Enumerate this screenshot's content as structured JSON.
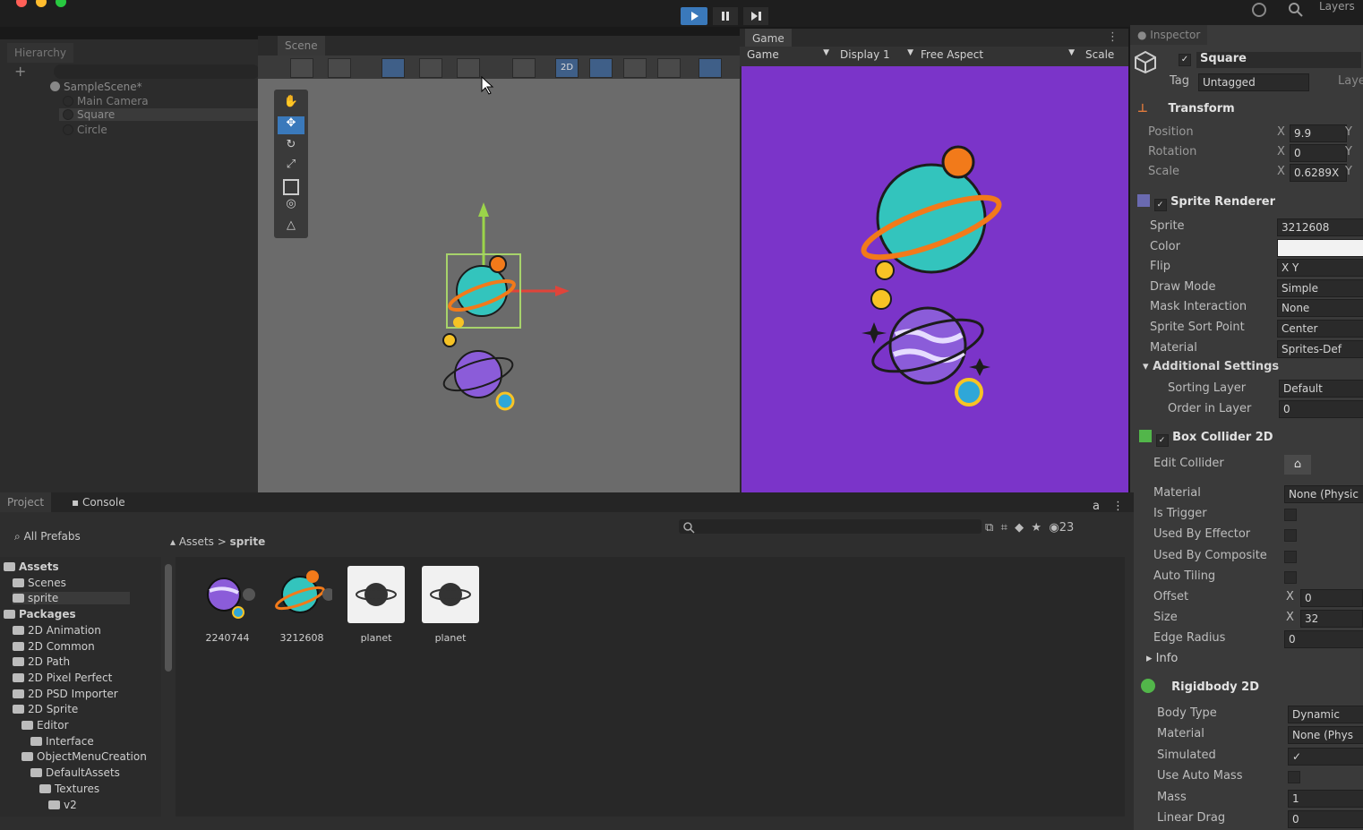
{
  "colors": {
    "accent": "#3a79bb",
    "game_bg": "#7b34c9",
    "planet_teal": "#33c4bd",
    "planet_purple": "#8b5cd9",
    "orange": "#f27a1a"
  },
  "toolbar": {
    "play_icon": "play-icon",
    "pause_icon": "pause-icon",
    "step_icon": "step-icon",
    "layers_label": "Layers"
  },
  "hierarchy": {
    "tab_label": "Hierarchy",
    "scene": "SampleScene*",
    "items": [
      "Main Camera",
      "Square",
      "Circle"
    ]
  },
  "scene": {
    "tab_label": "Scene",
    "mode_2d": "2D"
  },
  "game": {
    "tab_label": "Game",
    "view_select": "Game",
    "display": "Display 1",
    "aspect": "Free Aspect",
    "scale_label": "Scale"
  },
  "inspector": {
    "tab_label": "Inspector",
    "object_name": "Square",
    "tag_label": "Tag",
    "tag_value": "Untagged",
    "layer_label": "Layer",
    "transform": {
      "title": "Transform",
      "rows": [
        {
          "label": "Position",
          "axis": "X",
          "value": "9.9",
          "axis2": "Y"
        },
        {
          "label": "Rotation",
          "axis": "X",
          "value": "0",
          "axis2": "Y"
        },
        {
          "label": "Scale",
          "axis": "X",
          "value": "0.6289X",
          "axis2": "Y"
        }
      ]
    },
    "sprite_renderer": {
      "title": "Sprite Renderer",
      "rows": [
        {
          "label": "Sprite",
          "value": "3212608"
        },
        {
          "label": "Color",
          "value": ""
        },
        {
          "label": "Flip",
          "value": "X   Y"
        },
        {
          "label": "Draw Mode",
          "value": "Simple"
        },
        {
          "label": "Mask Interaction",
          "value": "None"
        },
        {
          "label": "Sprite Sort Point",
          "value": "Center"
        },
        {
          "label": "Material",
          "value": "Sprites-Def"
        }
      ],
      "additional": "Additional Settings",
      "sorting_layer_label": "Sorting Layer",
      "sorting_layer_value": "Default",
      "order_label": "Order in Layer",
      "order_value": "0"
    },
    "box_collider": {
      "title": "Box Collider 2D",
      "edit_label": "Edit Collider",
      "rows": [
        {
          "label": "Material",
          "value": "None (Physic"
        },
        {
          "label": "Is Trigger",
          "value": ""
        },
        {
          "label": "Used By Effector",
          "value": ""
        },
        {
          "label": "Used By Composite",
          "value": ""
        },
        {
          "label": "Auto Tiling",
          "value": ""
        },
        {
          "label": "Offset",
          "axis": "X",
          "value": "0"
        },
        {
          "label": "Size",
          "axis": "X",
          "value": "32"
        },
        {
          "label": "Edge Radius",
          "value": "0"
        }
      ],
      "info": "Info"
    },
    "rigidbody": {
      "title": "Rigidbody 2D",
      "rows": [
        {
          "label": "Body Type",
          "value": "Dynamic"
        },
        {
          "label": "Material",
          "value": "None (Phys"
        },
        {
          "label": "Simulated",
          "value": "✓"
        },
        {
          "label": "Use Auto Mass",
          "value": ""
        },
        {
          "label": "Mass",
          "value": "1"
        },
        {
          "label": "Linear Drag",
          "value": "0"
        }
      ]
    }
  },
  "project": {
    "tab_project": "Project",
    "tab_console": "Console",
    "all_prefabs": "All Prefabs",
    "breadcrumb": [
      "Assets",
      "sprite"
    ],
    "hidden_count": "23",
    "tree": [
      {
        "label": "Assets",
        "indent": 0
      },
      {
        "label": "Scenes",
        "indent": 1
      },
      {
        "label": "sprite",
        "indent": 1
      },
      {
        "label": "Packages",
        "indent": 0
      },
      {
        "label": "2D Animation",
        "indent": 1
      },
      {
        "label": "2D Common",
        "indent": 1
      },
      {
        "label": "2D Path",
        "indent": 1
      },
      {
        "label": "2D Pixel Perfect",
        "indent": 1
      },
      {
        "label": "2D PSD Importer",
        "indent": 1
      },
      {
        "label": "2D Sprite",
        "indent": 1
      },
      {
        "label": "Editor",
        "indent": 2
      },
      {
        "label": "Interface",
        "indent": 3
      },
      {
        "label": "ObjectMenuCreation",
        "indent": 2
      },
      {
        "label": "DefaultAssets",
        "indent": 3
      },
      {
        "label": "Textures",
        "indent": 4
      },
      {
        "label": "v2",
        "indent": 5
      }
    ],
    "assets": [
      {
        "name": "2240744",
        "kind": "purple"
      },
      {
        "name": "3212608",
        "kind": "teal"
      },
      {
        "name": "planet",
        "kind": "white"
      },
      {
        "name": "planet",
        "kind": "white"
      }
    ]
  }
}
